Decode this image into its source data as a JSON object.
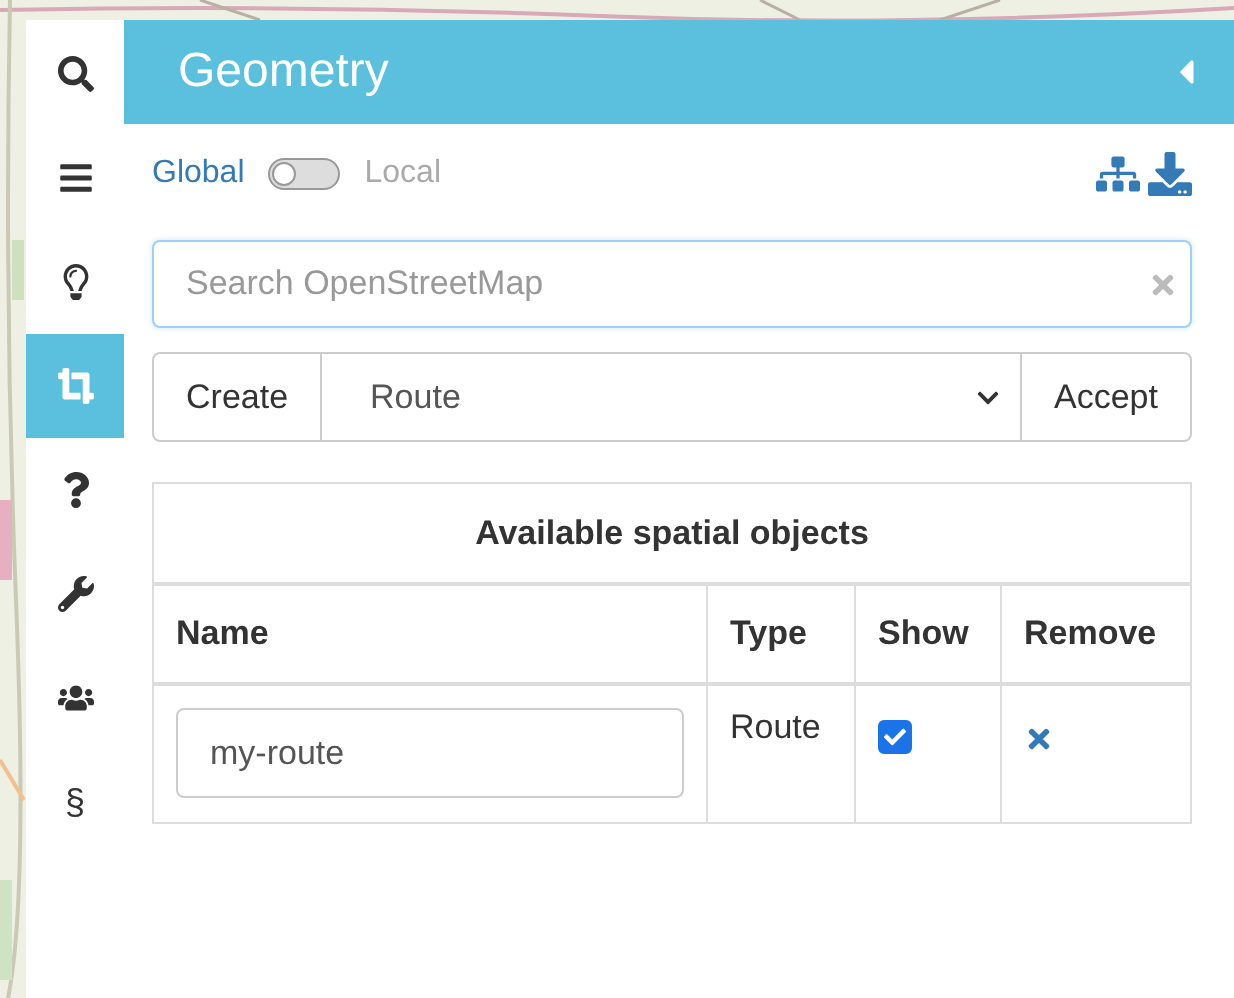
{
  "sidebar": {
    "tabs": [
      {
        "kind": "search",
        "selected": false
      },
      {
        "kind": "bars",
        "selected": false
      },
      {
        "kind": "lightbulb",
        "selected": false
      },
      {
        "kind": "crop",
        "selected": true
      },
      {
        "kind": "question",
        "selected": false
      },
      {
        "kind": "wrench",
        "selected": false
      },
      {
        "kind": "users",
        "selected": false
      },
      {
        "kind": "text",
        "label": "§",
        "selected": false
      }
    ]
  },
  "panel": {
    "title": "Geometry",
    "scope_toggle": {
      "left_label": "Global",
      "right_label": "Local",
      "on": false
    },
    "search": {
      "placeholder": "Search OpenStreetMap"
    },
    "create_row": {
      "create_button": "Create",
      "type_select": "Route",
      "accept_button": "Accept"
    },
    "table": {
      "title": "Available spatial objects",
      "columns": [
        "Name",
        "Type",
        "Show",
        "Remove"
      ],
      "rows": [
        {
          "name": "my-route",
          "type": "Route",
          "show": true
        }
      ]
    }
  }
}
